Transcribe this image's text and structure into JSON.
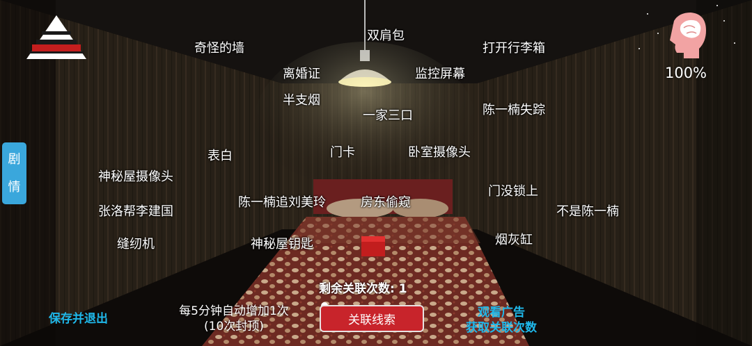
{
  "clues": [
    {
      "id": "clue-backpack",
      "label": "双肩包"
    },
    {
      "id": "clue-strange-wall",
      "label": "奇怪的墙"
    },
    {
      "id": "clue-open-suitcase",
      "label": "打开行李箱"
    },
    {
      "id": "clue-divorce-cert",
      "label": "离婚证"
    },
    {
      "id": "clue-monitor-screen",
      "label": "监控屏幕"
    },
    {
      "id": "clue-half-cigarette",
      "label": "半支烟"
    },
    {
      "id": "clue-family-of-three",
      "label": "一家三口"
    },
    {
      "id": "clue-chen-missing",
      "label": "陈一楠失踪"
    },
    {
      "id": "clue-confession",
      "label": "表白"
    },
    {
      "id": "clue-door-card",
      "label": "门卡"
    },
    {
      "id": "clue-bedroom-camera",
      "label": "卧室摄像头"
    },
    {
      "id": "clue-mystery-room-camera",
      "label": "神秘屋摄像头"
    },
    {
      "id": "clue-door-unlocked",
      "label": "门没锁上"
    },
    {
      "id": "clue-chen-chases-liu",
      "label": "陈一楠追刘美玲"
    },
    {
      "id": "clue-landlord-peeping",
      "label": "房东偷窥"
    },
    {
      "id": "clue-zhang-helps-li",
      "label": "张洛帮李建国"
    },
    {
      "id": "clue-not-chen",
      "label": "不是陈一楠"
    },
    {
      "id": "clue-sewing-machine",
      "label": "缝纫机"
    },
    {
      "id": "clue-mystery-room-key",
      "label": "神秘屋钥匙"
    },
    {
      "id": "clue-ashtray",
      "label": "烟灰缸"
    }
  ],
  "side_tab": {
    "char1": "剧",
    "char2": "情"
  },
  "save_exit": "保存并退出",
  "auto_info": {
    "line1": "每5分钟自动增加1次",
    "line2": "(10次封顶)"
  },
  "remaining": "剩余关联次数: 1",
  "link_button": "关联线索",
  "watch_ad": {
    "line1": "观看广告",
    "line2": "获取关联次数"
  },
  "sanity": "100%",
  "colors": {
    "accent": "#1fb8ea",
    "button": "#c8242b",
    "tab": "#3aa7dc"
  }
}
